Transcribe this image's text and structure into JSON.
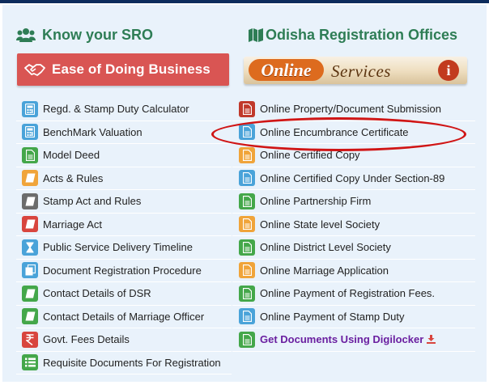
{
  "left": {
    "heading": "Know your SRO",
    "banner": "Ease of Doing Business",
    "items": [
      {
        "label": "Regd. & Stamp Duty Calculator",
        "icon": "calculator-icon",
        "color": "blue"
      },
      {
        "label": "BenchMark Valuation",
        "icon": "calculator-icon",
        "color": "blue"
      },
      {
        "label": "Model Deed",
        "icon": "document-icon",
        "color": "green"
      },
      {
        "label": "Acts & Rules",
        "icon": "book-icon",
        "color": "orange"
      },
      {
        "label": "Stamp Act and Rules",
        "icon": "book-icon",
        "color": "gray"
      },
      {
        "label": " Marriage Act",
        "icon": "book-icon",
        "color": "red"
      },
      {
        "label": "Public Service Delivery Timeline",
        "icon": "hourglass-icon",
        "color": "blue"
      },
      {
        "label": "Document Registration Procedure",
        "icon": "copy-icon",
        "color": "blue"
      },
      {
        "label": "Contact Details of DSR",
        "icon": "book-icon",
        "color": "green"
      },
      {
        "label": "Contact Details of Marriage Officer",
        "icon": "book-icon",
        "color": "green"
      },
      {
        "label": "Govt. Fees Details",
        "icon": "rupee-icon",
        "color": "red"
      },
      {
        "label": "Requisite Documents For Registration",
        "icon": "list-icon",
        "color": "green"
      }
    ]
  },
  "right": {
    "heading": "Odisha Registration Offices",
    "banner_logo": "Online",
    "banner_text": "Services",
    "banner_info": "i",
    "items": [
      {
        "label": "Online Property/Document Submission",
        "icon": "document-icon",
        "color": "darkred"
      },
      {
        "label": "Online Encumbrance Certificate",
        "icon": "document-icon",
        "color": "blue"
      },
      {
        "label": "Online Certified Copy",
        "icon": "document-icon",
        "color": "orange"
      },
      {
        "label": "Online Certified Copy Under Section-89",
        "icon": "document-icon",
        "color": "blue"
      },
      {
        "label": "Online Partnership Firm",
        "icon": "document-icon",
        "color": "green"
      },
      {
        "label": "Online State level Society",
        "icon": "document-icon",
        "color": "orange"
      },
      {
        "label": "Online District Level Society",
        "icon": "document-icon",
        "color": "green"
      },
      {
        "label": "Online Marriage Application",
        "icon": "document-icon",
        "color": "orange"
      },
      {
        "label": "Online Payment of Registration Fees.",
        "icon": "document-icon",
        "color": "green"
      },
      {
        "label": "Online Payment of Stamp Duty",
        "icon": "document-icon",
        "color": "blue"
      },
      {
        "label": "Get Documents Using Digilocker",
        "icon": "document-icon",
        "color": "green"
      }
    ]
  },
  "colors": {
    "heading": "#2e7d55",
    "banner_red": "#d95553",
    "panel": "#e9f2fb",
    "highlight_ellipse": "#d01515",
    "digilocker_text": "#6a1fa0"
  }
}
